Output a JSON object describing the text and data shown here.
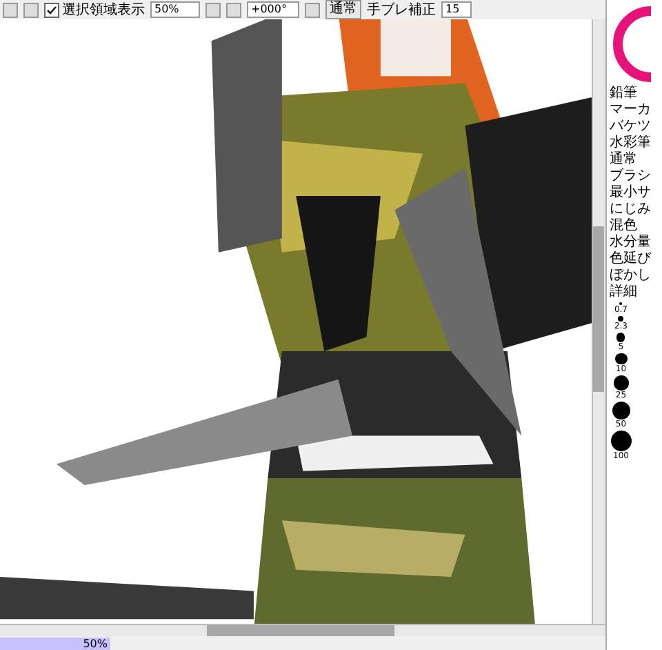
{
  "toolbar": {
    "selection_display": {
      "label": "選択領域表示",
      "checked": true
    },
    "zoom": "50%",
    "rotation": "+000°",
    "blend_mode": "通常",
    "stabilizer_label": "手ブレ補正",
    "stabilizer": "15"
  },
  "tools": [
    "鉛筆",
    "マーカ",
    "バケツ",
    "水彩筆"
  ],
  "brush_settings": [
    "通常",
    "ブラシ",
    "最小サ",
    "にじみ",
    "混色",
    "水分量",
    "色延び",
    "ぼかし",
    "詳細"
  ],
  "brush_sizes": [
    "0.7",
    "2.3",
    "5",
    "10",
    "25",
    "50",
    "100"
  ],
  "status_bar": {
    "zoom": "50%"
  }
}
